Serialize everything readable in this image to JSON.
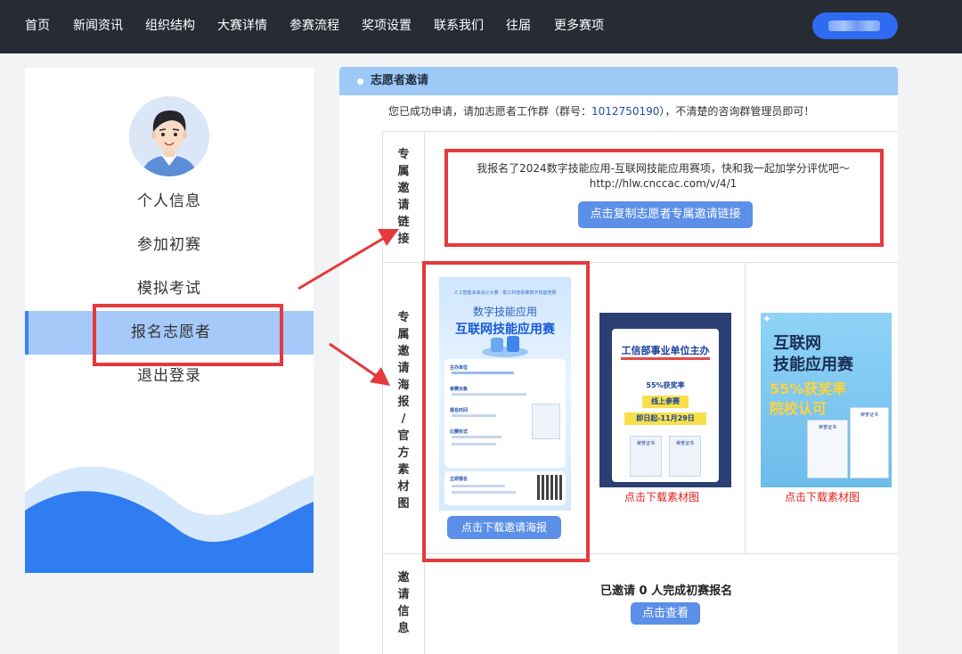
{
  "nav": {
    "items": [
      "首页",
      "新闻资讯",
      "组织结构",
      "大赛详情",
      "参赛流程",
      "奖项设置",
      "联系我们",
      "往届",
      "更多赛项"
    ]
  },
  "sidebar": {
    "items": [
      {
        "label": "个人信息"
      },
      {
        "label": "参加初赛"
      },
      {
        "label": "模拟考试"
      },
      {
        "label": "报名志愿者"
      },
      {
        "label": "退出登录"
      }
    ],
    "active_index": 3
  },
  "panel": {
    "title": "志愿者邀请",
    "notice_prefix": "您已成功申请，请加志愿者工作群（群号：",
    "notice_number": "1012750190",
    "notice_suffix": "），不清楚的咨询群管理员即可！"
  },
  "link_section": {
    "label": [
      "专",
      "属",
      "邀",
      "请",
      "链",
      "接"
    ],
    "line1": "我报名了2024数字技能应用-互联网技能应用赛项，快和我一起加学分评优吧～",
    "line2": "http://hlw.cnccac.com/v/4/1",
    "copy_button": "点击复制志愿者专属邀请链接"
  },
  "poster_section": {
    "label": [
      "专",
      "属",
      "邀",
      "请",
      "海",
      "报",
      "/",
      "官",
      "方",
      "素",
      "材",
      "图"
    ],
    "download_poster_button": "点击下载邀请海报",
    "download_material_1": "点击下载素材图",
    "download_material_2": "点击下载素材图",
    "poster_main": {
      "top_banner": "人工智能未来设计大赛 · 职工科技助推数字技能竞赛",
      "subtitle": "数字技能应用",
      "title": "互联网技能应用赛",
      "organizer_label": "主办单位",
      "target_label": "参赛对象",
      "time_label": "报名时间",
      "format_label": "比赛形式",
      "signup_label": "立即报名"
    },
    "material_1": {
      "title": "工信部事业单位主办",
      "badge1": "55%获奖率",
      "badge2": "线上参赛",
      "deadline": "即日起-11月29日",
      "cert": "荣誉证书"
    },
    "material_2": {
      "line1": "互联网",
      "line2": "技能应用赛",
      "line3": "55%获奖率",
      "line4": "院校认可",
      "cert": "荣誉证书"
    }
  },
  "invite_section": {
    "label": [
      "邀",
      "请",
      "信",
      "息"
    ],
    "text": "已邀请 0 人完成初赛报名",
    "view_button": "点击查看"
  },
  "colors": {
    "nav_bg": "#262b34",
    "header_blue": "#9ec9f7",
    "button_blue": "#5b8fe8",
    "annotation_red": "#e5393b",
    "link_red": "#e02020"
  }
}
